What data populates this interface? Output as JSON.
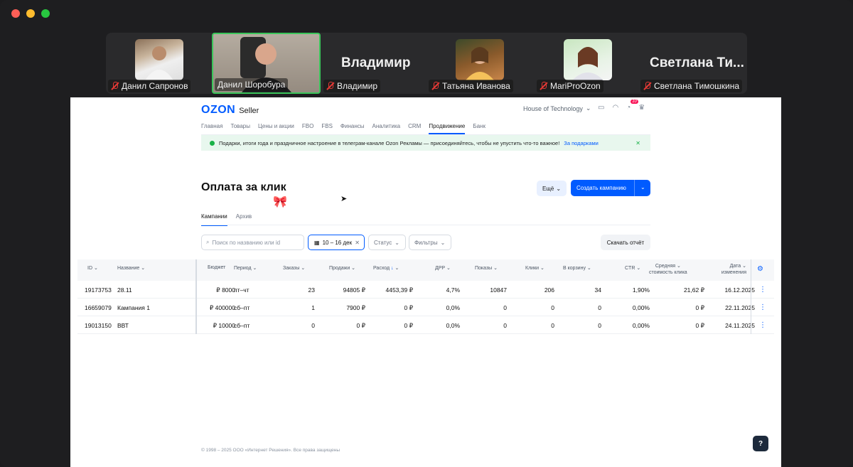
{
  "participants": [
    {
      "name": "Данил Сапронов",
      "muted": true,
      "video": true
    },
    {
      "name": "Данил Шоробура",
      "muted": false,
      "video": true,
      "active": true
    },
    {
      "name": "Владимир",
      "muted": true,
      "video": false,
      "big_name": "Владимир"
    },
    {
      "name": "Татьяна Иванова",
      "muted": true,
      "video": true
    },
    {
      "name": "MariProOzon",
      "muted": true,
      "video": true
    },
    {
      "name": "Светлана Тимошкина",
      "muted": true,
      "video": false,
      "big_name": "Светлана Ти..."
    }
  ],
  "header": {
    "logo": "OZON",
    "logo_sub": "Seller",
    "company": "House of Technology",
    "notifications": "10"
  },
  "nav": [
    "Главная",
    "Товары",
    "Цены и акции",
    "FBO",
    "FBS",
    "Финансы",
    "Аналитика",
    "CRM",
    "Продвижение",
    "Банк"
  ],
  "nav_active": "Продвижение",
  "banner": {
    "text": "Подарки, итоги года и праздничное настроение в телеграм-канале Ozon Рекламы — присоединяйтесь, чтобы не упустить что-то важное!",
    "link": "За подарками"
  },
  "title": "Оплата за клик",
  "buttons": {
    "more": "Ещё",
    "create": "Создать кампанию",
    "report": "Скачать отчёт"
  },
  "tabs": [
    "Кампании",
    "Архив"
  ],
  "filters": {
    "search_placeholder": "Поиск по названию или id",
    "date": "10 – 16 дек",
    "status": "Статус",
    "filters": "Фильтры"
  },
  "table": {
    "headers": [
      "ID",
      "Название",
      "Бюджет",
      "Период",
      "Заказы",
      "Продажи",
      "Расход",
      "ДРР",
      "Показы",
      "Клики",
      "В корзину",
      "CTR",
      "Средняя стоимость клика",
      "Дата изменения"
    ],
    "header_avg_line1": "Средняя",
    "header_avg_line2": "стоимость клика",
    "header_date_line1": "Дата",
    "header_date_line2": "изменения",
    "rows": [
      {
        "id": "19173753",
        "name": "28.11",
        "budget": "8000 ₽",
        "period": "пт–чт",
        "orders": "23",
        "sales": "94805 ₽",
        "spend": "4453,39 ₽",
        "drr": "4,7%",
        "impressions": "10847",
        "clicks": "206",
        "cart": "34",
        "ctr": "1,90%",
        "avg_cpc": "21,62 ₽",
        "changed": "16.12.2025"
      },
      {
        "id": "16659079",
        "name": "Кампания 1",
        "budget": "400000 ₽",
        "period": "сб–пт",
        "orders": "1",
        "sales": "7900 ₽",
        "spend": "0 ₽",
        "drr": "0,0%",
        "impressions": "0",
        "clicks": "0",
        "cart": "0",
        "ctr": "0,00%",
        "avg_cpc": "0 ₽",
        "changed": "22.11.2025"
      },
      {
        "id": "19013150",
        "name": "ВВТ",
        "budget": "10000 ₽",
        "period": "сб–пт",
        "orders": "0",
        "sales": "0 ₽",
        "spend": "0 ₽",
        "drr": "0,0%",
        "impressions": "0",
        "clicks": "0",
        "cart": "0",
        "ctr": "0,00%",
        "avg_cpc": "0 ₽",
        "changed": "24.11.2025"
      }
    ]
  },
  "footer": "© 1998 – 2025 ООО «Интернет Решения». Все права защищены",
  "help": "?"
}
